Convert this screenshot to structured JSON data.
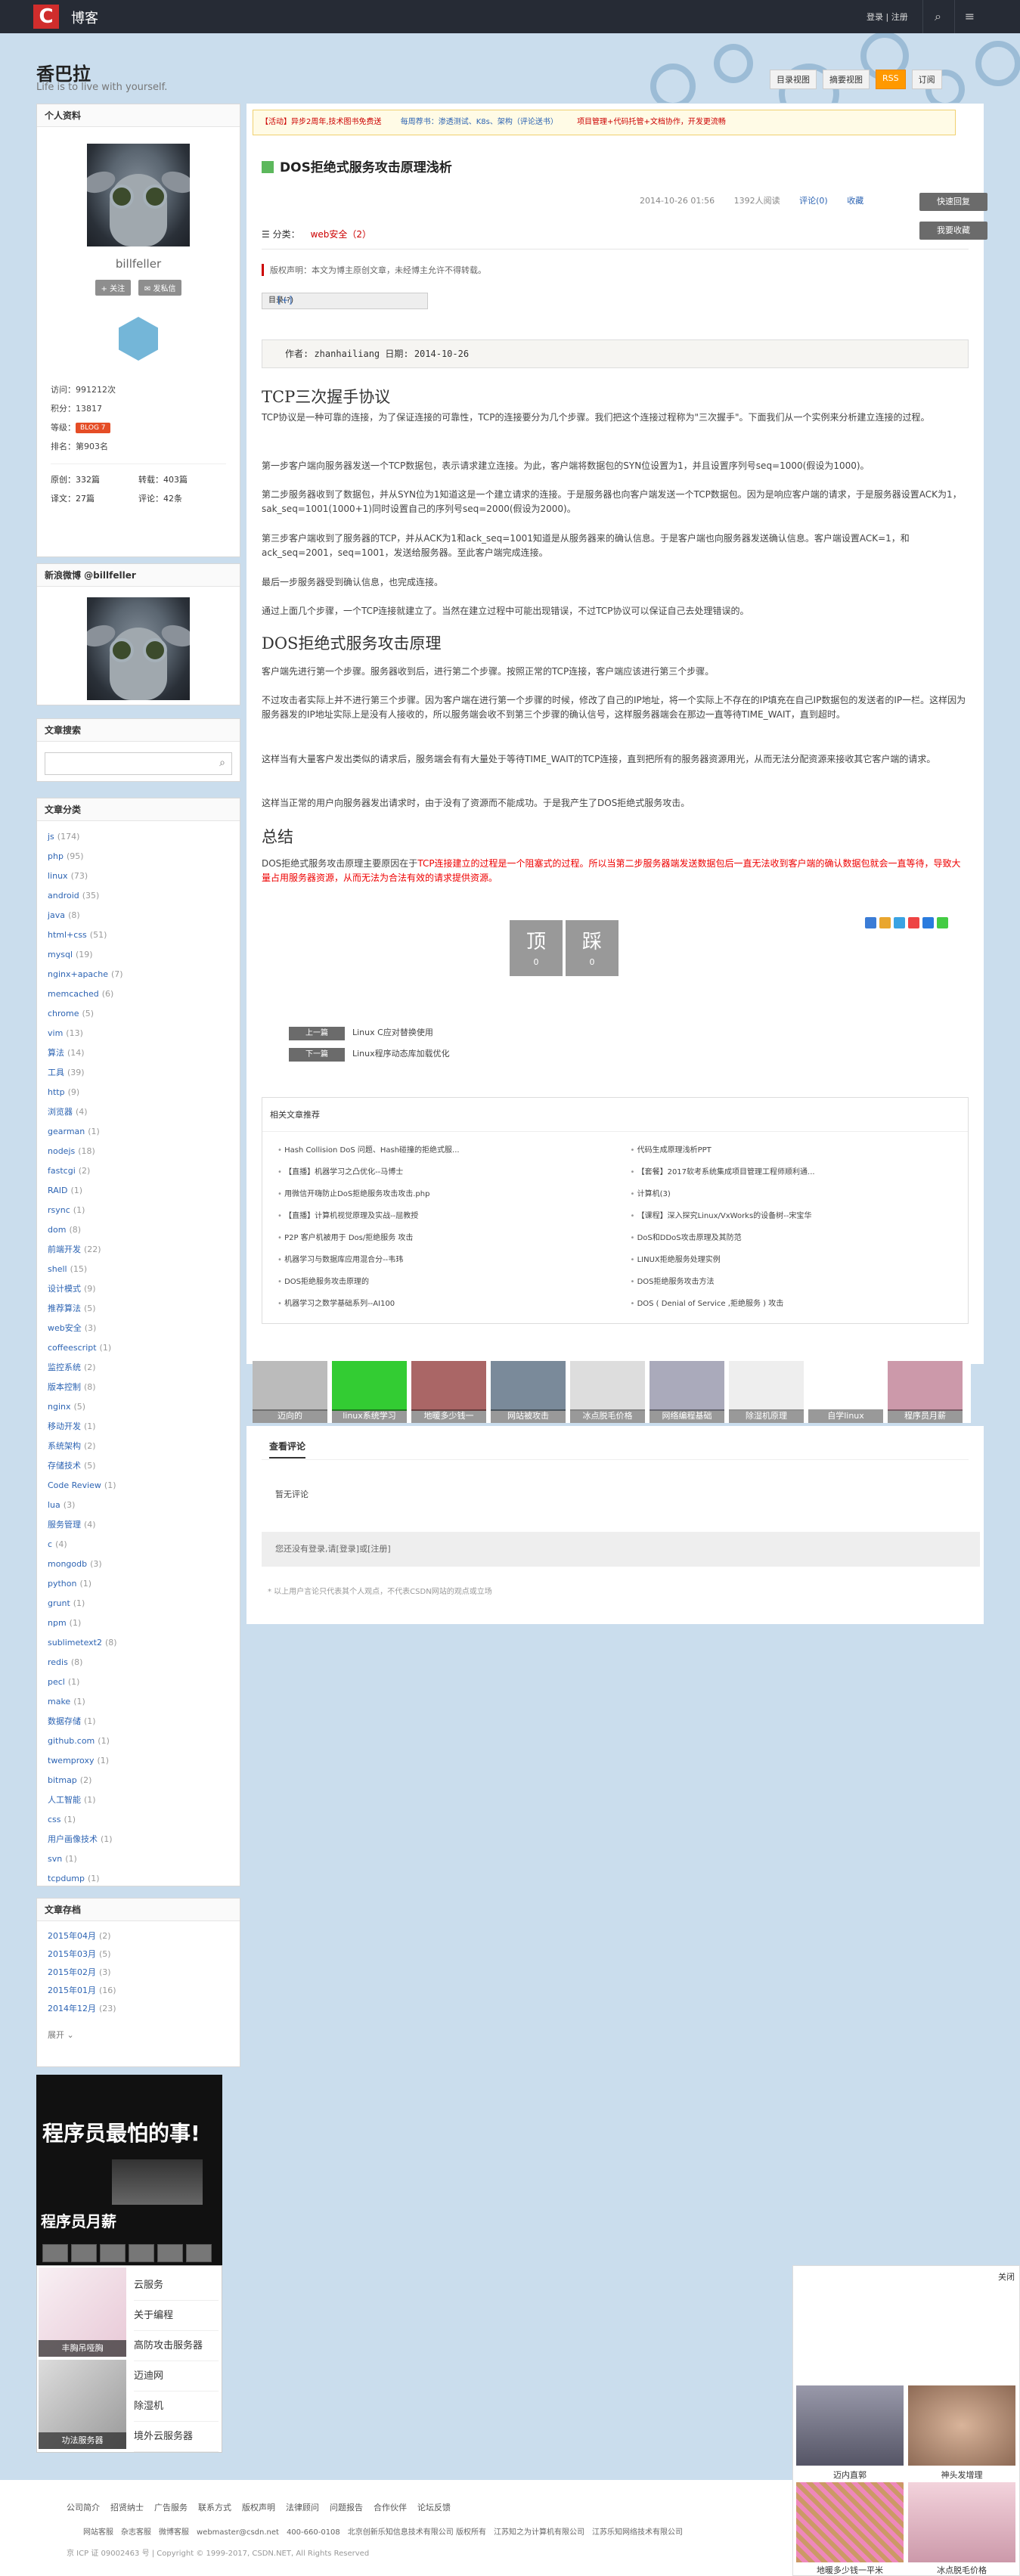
{
  "topbar": {
    "brand": "博客",
    "login": "登录 | 注册",
    "logo": "C"
  },
  "blog": {
    "title": "香巴拉",
    "subtitle": "Life is to live with yourself."
  },
  "views": {
    "dir": "目录视图",
    "summary": "摘要视图",
    "rss_label": "RSS",
    "subscribe": "订阅"
  },
  "profile": {
    "header": "个人资料",
    "username": "billfeller",
    "follow": "关注",
    "message": "发私信",
    "visits_label": "访问：",
    "visits": "991212次",
    "points_label": "积分：",
    "points": "13817",
    "level_label": "等级：",
    "level": "BLOG 7",
    "rank_label": "排名：",
    "rank": "第903名",
    "orig_label": "原创：",
    "orig": "332篇",
    "repost_label": "转载：",
    "repost": "403篇",
    "trans_label": "译文：",
    "trans": "27篇",
    "comment_label": "评论：",
    "comment": "42条"
  },
  "weibo": {
    "header": "新浪微博 @billfeller"
  },
  "search": {
    "header": "文章搜索"
  },
  "categories": {
    "header": "文章分类",
    "items": [
      {
        "n": "js",
        "c": "(174)"
      },
      {
        "n": "php",
        "c": "(95)"
      },
      {
        "n": "linux",
        "c": "(73)"
      },
      {
        "n": "android",
        "c": "(35)"
      },
      {
        "n": "java",
        "c": "(8)"
      },
      {
        "n": "html+css",
        "c": "(51)"
      },
      {
        "n": "mysql",
        "c": "(19)"
      },
      {
        "n": "nginx+apache",
        "c": "(7)"
      },
      {
        "n": "memcached",
        "c": "(6)"
      },
      {
        "n": "chrome",
        "c": "(5)"
      },
      {
        "n": "vim",
        "c": "(13)"
      },
      {
        "n": "算法",
        "c": "(14)"
      },
      {
        "n": "工具",
        "c": "(39)"
      },
      {
        "n": "http",
        "c": "(9)"
      },
      {
        "n": "浏览器",
        "c": "(4)"
      },
      {
        "n": "gearman",
        "c": "(1)"
      },
      {
        "n": "nodejs",
        "c": "(18)"
      },
      {
        "n": "fastcgi",
        "c": "(2)"
      },
      {
        "n": "RAID",
        "c": "(1)"
      },
      {
        "n": "rsync",
        "c": "(1)"
      },
      {
        "n": "dom",
        "c": "(8)"
      },
      {
        "n": "前端开发",
        "c": "(22)"
      },
      {
        "n": "shell",
        "c": "(15)"
      },
      {
        "n": "设计模式",
        "c": "(9)"
      },
      {
        "n": "推荐算法",
        "c": "(5)"
      },
      {
        "n": "web安全",
        "c": "(3)"
      },
      {
        "n": "coffeescript",
        "c": "(1)"
      },
      {
        "n": "监控系统",
        "c": "(2)"
      },
      {
        "n": "版本控制",
        "c": "(8)"
      },
      {
        "n": "nginx",
        "c": "(5)"
      },
      {
        "n": "移动开发",
        "c": "(1)"
      },
      {
        "n": "系统架构",
        "c": "(2)"
      },
      {
        "n": "存储技术",
        "c": "(5)"
      },
      {
        "n": "Code Review",
        "c": "(1)"
      },
      {
        "n": "lua",
        "c": "(3)"
      },
      {
        "n": "服务管理",
        "c": "(4)"
      },
      {
        "n": "c",
        "c": "(4)"
      },
      {
        "n": "mongodb",
        "c": "(3)"
      },
      {
        "n": "python",
        "c": "(1)"
      },
      {
        "n": "grunt",
        "c": "(1)"
      },
      {
        "n": "npm",
        "c": "(1)"
      },
      {
        "n": "sublimetext2",
        "c": "(8)"
      },
      {
        "n": "redis",
        "c": "(8)"
      },
      {
        "n": "pecl",
        "c": "(1)"
      },
      {
        "n": "make",
        "c": "(1)"
      },
      {
        "n": "数据存储",
        "c": "(1)"
      },
      {
        "n": "github.com",
        "c": "(1)"
      },
      {
        "n": "twemproxy",
        "c": "(1)"
      },
      {
        "n": "bitmap",
        "c": "(2)"
      },
      {
        "n": "人工智能",
        "c": "(1)"
      },
      {
        "n": "css",
        "c": "(1)"
      },
      {
        "n": "用户画像技术",
        "c": "(1)"
      },
      {
        "n": "svn",
        "c": "(1)"
      },
      {
        "n": "tcpdump",
        "c": "(1)"
      }
    ]
  },
  "archive": {
    "header": "文章存档",
    "items": [
      {
        "n": "2015年04月",
        "c": "(2)"
      },
      {
        "n": "2015年03月",
        "c": "(5)"
      },
      {
        "n": "2015年02月",
        "c": "(3)"
      },
      {
        "n": "2015年01月",
        "c": "(16)"
      },
      {
        "n": "2014年12月",
        "c": "(23)"
      }
    ],
    "expand": "展开"
  },
  "ad_left": {
    "title": "程序员最怕的事!",
    "sub": "程序员月薪",
    "img1": "丰胸吊哑胸",
    "img2": "功法服务器",
    "links": [
      "云服务",
      "关于编程",
      "高防攻击服务器",
      "迈迪网",
      "除湿机",
      "境外云服务器"
    ]
  },
  "notice": {
    "items": [
      "【活动】异步2周年,技术图书免费送",
      "每周荐书：渗透测试、K8s、架构（评论送书）",
      "项目管理+代码托管+文档协作，开发更流畅"
    ]
  },
  "article": {
    "title": "DOS拒绝式服务攻击原理浅析",
    "date": "2014-10-26 01:56",
    "reads": "1392人阅读",
    "comments": "评论(0)",
    "collect": "收藏",
    "report": "举报",
    "quick_reply": "快速回复",
    "my_collect": "我要收藏",
    "category_label": "分类：",
    "category": "web安全（2）",
    "copyright": "版权声明：本文为博主原创文章，未经博主允许不得转载。",
    "toc": "目录(?)",
    "toc_toggle": "[+]",
    "author_line": "作者: zhanhailiang 日期: 2014-10-26",
    "h1": "TCP三次握手协议",
    "p1": "TCP协议是一种可靠的连接，为了保证连接的可靠性，TCP的连接要分为几个步骤。我们把这个连接过程称为\"三次握手\"。下面我们从一个实例来分析建立连接的过程。",
    "p2": "第一步客户端向服务器发送一个TCP数据包，表示请求建立连接。为此，客户端将数据包的SYN位设置为1，并且设置序列号seq=1000(假设为1000)。",
    "p3": "第二步服务器收到了数据包，并从SYN位为1知道这是一个建立请求的连接。于是服务器也向客户端发送一个TCP数据包。因为是响应客户端的请求，于是服务器设置ACK为1，sak_seq=1001(1000+1)同时设置自己的序列号seq=2000(假设为2000)。",
    "p4": "第三步客户端收到了服务器的TCP，并从ACK为1和ack_seq=1001知道是从服务器来的确认信息。于是客户端也向服务器发送确认信息。客户端设置ACK=1，和ack_seq=2001，seq=1001，发送给服务器。至此客户端完成连接。",
    "p5": "最后一步服务器受到确认信息，也完成连接。",
    "p6": "通过上面几个步骤，一个TCP连接就建立了。当然在建立过程中可能出现错误，不过TCP协议可以保证自己去处理错误的。",
    "h2": "DOS拒绝式服务攻击原理",
    "p7": "客户端先进行第一个步骤。服务器收到后，进行第二个步骤。按照正常的TCP连接，客户端应该进行第三个步骤。",
    "p8": "不过攻击者实际上并不进行第三个步骤。因为客户端在进行第一个步骤的时候，修改了自己的IP地址，将一个实际上不存在的IP填充在自己IP数据包的发送者的IP一栏。这样因为服务器发的IP地址实际上是没有人接收的，所以服务端会收不到第三个步骤的确认信号，这样服务器端会在那边一直等待TIME_WAIT，直到超时。",
    "p9": "这样当有大量客户发出类似的请求后，服务端会有有大量处于等待TIME_WAIT的TCP连接，直到把所有的服务器资源用光，从而无法分配资源来接收其它客户端的请求。",
    "p10": "这样当正常的用户向服务器发出请求时，由于没有了资源而不能成功。于是我产生了DOS拒绝式服务攻击。",
    "h3": "总结",
    "p11_a": "DOS拒绝式服务攻击原理主要原因在于",
    "p11_b": "TCP连接建立的过程是一个阻塞式的过程。所以当第二步服务器端发送数据包后一直无法收到客户端的确认数据包就会一直等待，导致大量占用服务器资源，从而无法为合法有效的请求提供资源。",
    "up": "顶",
    "up_n": "0",
    "down": "踩",
    "down_n": "0",
    "prev_tag": "上一篇",
    "prev": "Linux C应对替换使用",
    "next_tag": "下一篇",
    "next": "Linux程序动态库加载优化",
    "related_header": "相关文章推荐",
    "related": [
      "Hash Collision DoS 问题、Hash碰撞的拒绝式服...",
      "代码生成原理浅析PPT",
      "【直播】机器学习之凸优化--马博士",
      "【套餐】2017软考系统集成项目管理工程师顺利通...",
      "用微信开嗨防止DoS拒绝服务攻击攻击.php",
      "计算机(3)",
      "【直播】计算机视觉原理及实战--屈教授",
      "【课程】深入探究Linux/VxWorks的设备树--宋宝华",
      "P2P 客户机被用于 Dos/拒绝服务 攻击",
      "DoS和DDoS攻击原理及其防范",
      "机器学习与数据库应用混合分--韦玮",
      "LINUX拒绝服务处理实例",
      "DOS拒绝服务攻击原理的",
      "DOS拒绝服务攻击方法",
      "机器学习之数学基础系列--AI100",
      "DOS ( Denial of Service ,拒绝服务 ) 攻击"
    ]
  },
  "adstrip": [
    "迈向的",
    "linux系统学习",
    "地暖多少钱一",
    "网站被攻击",
    "冰点脱毛价格",
    "网络编程基础",
    "除湿机原理",
    "自学linux",
    "程序员月薪"
  ],
  "comments": {
    "header": "查看评论",
    "none": "暂无评论",
    "login_prompt": "您还没有登录,请[登录]或[注册]",
    "disclaimer": "* 以上用户言论只代表其个人观点，不代表CSDN网站的观点或立场"
  },
  "footer": {
    "links": [
      "公司简介",
      "招贤纳士",
      "广告服务",
      "联系方式",
      "版权声明",
      "法律顾问",
      "问题报告",
      "合作伙伴",
      "论坛反馈"
    ],
    "contact": [
      "网站客服",
      "杂志客服",
      "微博客服",
      "webmaster@csdn.net",
      "400-660-0108",
      "北京创新乐知信息技术有限公司 版权所有",
      "江苏知之为计算机有限公司",
      "江苏乐知网络技术有限公司"
    ],
    "copy": "京 ICP 证 09002463 号 | Copyright © 1999-2017, CSDN.NET, All Rights Reserved"
  },
  "floatad": {
    "close": "关闭",
    "items": [
      "迈内直郭",
      "神头发增理",
      "地暖多少钱一平米",
      "冰点脱毛价格"
    ]
  }
}
